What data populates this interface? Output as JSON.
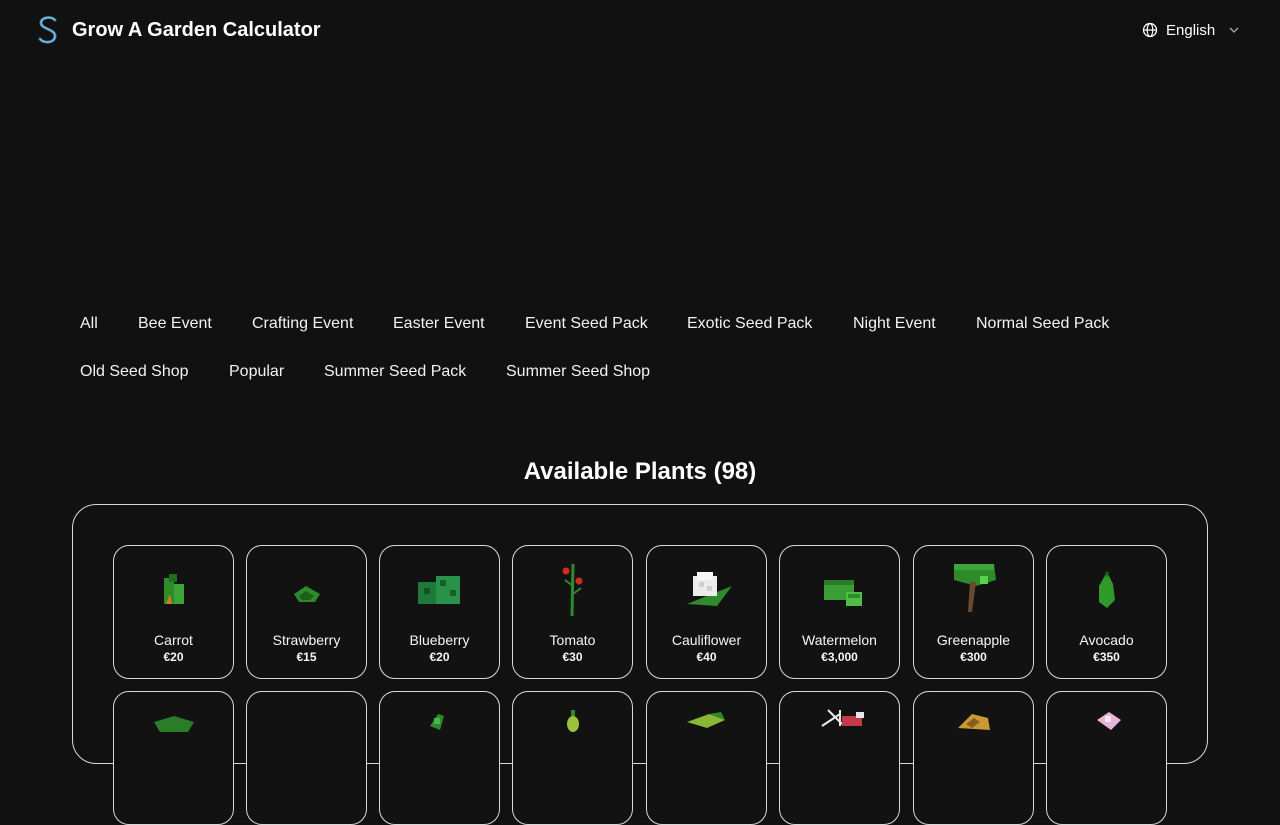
{
  "header": {
    "title": "Grow A Garden Calculator",
    "language": "English",
    "logo_icon": "s-logo-icon",
    "globe_icon": "globe-icon",
    "chevron_icon": "chevron-down-icon"
  },
  "filters": {
    "row1": [
      "All",
      "Bee Event",
      "Crafting Event",
      "Easter Event",
      "Event Seed Pack",
      "Exotic Seed Pack",
      "Night Event",
      "Normal Seed Pack"
    ],
    "row2": [
      "Old Seed Shop",
      "Popular",
      "Summer Seed Pack",
      "Summer Seed Shop"
    ]
  },
  "section": {
    "title": "Available Plants (98)"
  },
  "plants": [
    {
      "name": "Carrot",
      "price": "€20",
      "icon": "carrot-icon"
    },
    {
      "name": "Strawberry",
      "price": "€15",
      "icon": "strawberry-icon"
    },
    {
      "name": "Blueberry",
      "price": "€20",
      "icon": "blueberry-icon"
    },
    {
      "name": "Tomato",
      "price": "€30",
      "icon": "tomato-icon"
    },
    {
      "name": "Cauliflower",
      "price": "€40",
      "icon": "cauliflower-icon"
    },
    {
      "name": "Watermelon",
      "price": "€3,000",
      "icon": "watermelon-icon"
    },
    {
      "name": "Greenapple",
      "price": "€300",
      "icon": "greenapple-icon"
    },
    {
      "name": "Avocado",
      "price": "€350",
      "icon": "avocado-icon"
    }
  ],
  "colors": {
    "background": "#111111",
    "border": "#d9d9d9",
    "text": "#ffffff",
    "plant_green": "#2f8a2a"
  }
}
